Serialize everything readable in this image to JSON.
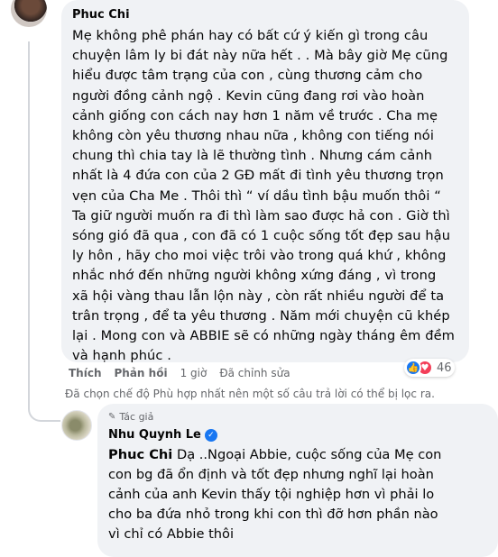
{
  "comment": {
    "author": "Phuc Chi",
    "lines": [
      "Mẹ không phê phán hay có bất cứ ý kiến gì trong câu",
      "chuyện lâm ly bi đát này nữa hết . . Mà bây giờ Mẹ cũng",
      "hiểu được tâm trạng của con , cùng thương cảm cho",
      "người đồng cảnh ngộ . Kevin cũng đang rơi vào hoàn",
      "cảnh giống con cách nay hơn 1 năm về trước . Cha mẹ",
      "không còn yêu thương nhau nữa , không con tiếng nói",
      "chung thì chia tay là lẽ thường tình . Nhưng cám cảnh",
      "nhất là 4 đứa con của 2 GĐ mất đi tình yêu thương trọn",
      "vẹn của Cha Me . Thôi thì “ ví dầu tình bậu muốn thôi “",
      "Ta giữ người muốn ra đi thì làm sao được hả con . Giờ thì",
      "sóng gió đã qua , con đã có 1 cuộc sống tốt đẹp sau hậu",
      "ly hôn , hãy cho moi việc trôi vào trong quá khứ , không",
      "nhắc nhớ đến những người không xứng đáng , vì trong",
      "xã hội vàng thau lẫn lộn này , còn rất nhiều người để ta",
      "trân trọng , để ta yêu thương . Năm mới chuyện cũ khép",
      "lại . Mong con và ABBIE sẽ có những ngày tháng êm đềm",
      "và hạnh phúc ."
    ],
    "actions": {
      "like": "Thích",
      "reply": "Phản hồi",
      "time": "1 giờ",
      "edited": "Đã chỉnh sửa"
    },
    "reaction_count": "46"
  },
  "filter_note": "Đã chọn chế độ Phù hợp nhất nên một số câu trả lời có thể bị lọc ra.",
  "reply": {
    "badge": "Tác giả",
    "author": "Nhu Quynh Le",
    "mention": "Phuc Chi",
    "first_line_rest": " Dạ ..Ngoại Abbie, cuộc sống của Mẹ con",
    "lines": [
      "con bg đã ổn định và tốt đẹp nhưng nghĩ lại hoàn",
      "cảnh của anh Kevin thấy tội nghiệp hơn vì phải lo",
      "cho ba đứa nhỏ trong khi con thì đỡ hơn phần nào",
      "vì chỉ có Abbie thôi"
    ]
  },
  "colors": {
    "bubble": "#f0f2f5",
    "secondary_text": "#65676b",
    "like_blue": "#1877f2",
    "love_red": "#f33e58"
  }
}
